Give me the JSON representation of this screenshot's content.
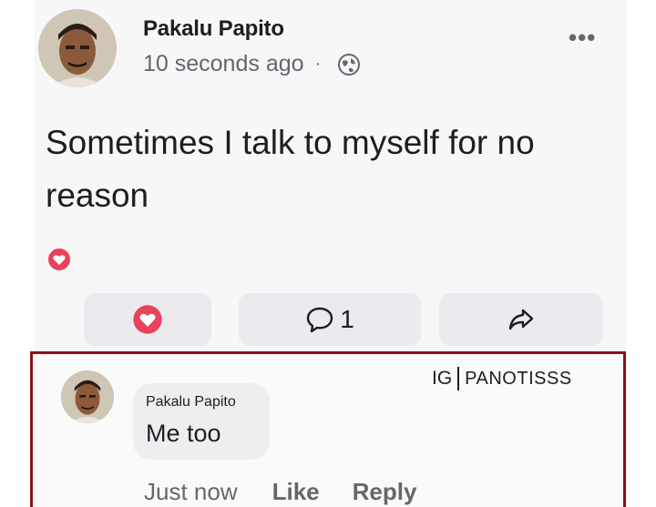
{
  "post": {
    "author": "Pakalu Papito",
    "timestamp": "10 seconds ago",
    "separator": "·",
    "audience_icon": "globe-icon",
    "more_icon": "•••",
    "text": "Sometimes I talk to myself for no reason",
    "reaction_icon": "love-reaction-icon",
    "actions": {
      "love_icon": "love-icon",
      "comment_icon": "comment-icon",
      "comment_count": "1",
      "share_icon": "share-icon"
    }
  },
  "comment": {
    "author": "Pakalu Papito",
    "text": "Me too",
    "time": "Just now",
    "like_label": "Like",
    "reply_label": "Reply"
  },
  "watermark": {
    "prefix": "IG",
    "handle": "PANOTISSS"
  },
  "colors": {
    "love": "#e8435a",
    "highlight_border": "#8a1218",
    "secondary_text": "#606770"
  }
}
